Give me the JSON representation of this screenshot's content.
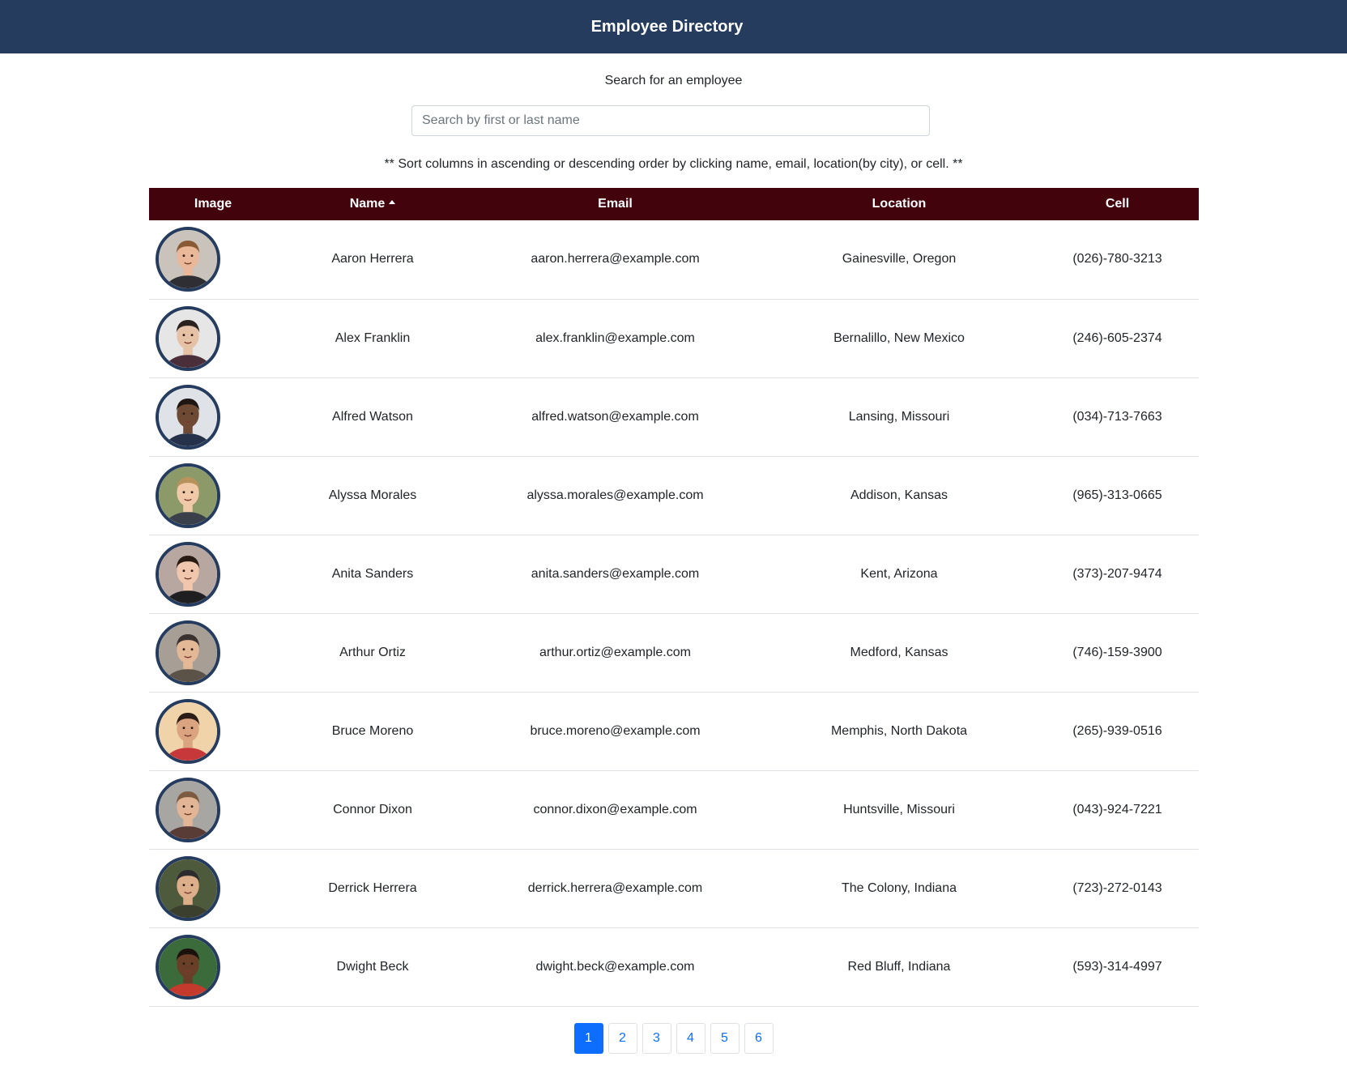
{
  "header": {
    "title": "Employee Directory"
  },
  "search": {
    "label": "Search for an employee",
    "placeholder": "Search by first or last name",
    "value": ""
  },
  "sort_note": "** Sort columns in ascending or descending order by clicking name, email, location(by city), or cell. **",
  "table": {
    "columns": [
      "Image",
      "Name",
      "Email",
      "Location",
      "Cell"
    ],
    "sorted_by": "Name",
    "sort_direction": "ascending",
    "rows": [
      {
        "name": "Aaron Herrera",
        "email": "aaron.herrera@example.com",
        "location": "Gainesville, Oregon",
        "cell": "(026)-780-3213",
        "bg": "#c9c3bb",
        "skin": "#e9b79a",
        "hair": "#8a5a34",
        "shirt": "#2f2f33"
      },
      {
        "name": "Alex Franklin",
        "email": "alex.franklin@example.com",
        "location": "Bernalillo, New Mexico",
        "cell": "(246)-605-2374",
        "bg": "#e6e6e6",
        "skin": "#e5c1a6",
        "hair": "#2b2220",
        "shirt": "#4a2e3a"
      },
      {
        "name": "Alfred Watson",
        "email": "alfred.watson@example.com",
        "location": "Lansing, Missouri",
        "cell": "(034)-713-7663",
        "bg": "#dfe3e8",
        "skin": "#6e4a35",
        "hair": "#1e1612",
        "shirt": "#26324a"
      },
      {
        "name": "Alyssa Morales",
        "email": "alyssa.morales@example.com",
        "location": "Addison, Kansas",
        "cell": "(965)-313-0665",
        "bg": "#8c9a6a",
        "skin": "#f0c9a9",
        "hair": "#b8925c",
        "shirt": "#39404a"
      },
      {
        "name": "Anita Sanders",
        "email": "anita.sanders@example.com",
        "location": "Kent, Arizona",
        "cell": "(373)-207-9474",
        "bg": "#b8a7a0",
        "skin": "#f0c6ad",
        "hair": "#2a1a14",
        "shirt": "#1f1f22"
      },
      {
        "name": "Arthur Ortiz",
        "email": "arthur.ortiz@example.com",
        "location": "Medford, Kansas",
        "cell": "(746)-159-3900",
        "bg": "#a79f95",
        "skin": "#e3b896",
        "hair": "#3a3230",
        "shirt": "#5b5248"
      },
      {
        "name": "Bruce Moreno",
        "email": "bruce.moreno@example.com",
        "location": "Memphis, North Dakota",
        "cell": "(265)-939-0516",
        "bg": "#f0d3a8",
        "skin": "#d9a47f",
        "hair": "#2a1d17",
        "shirt": "#c6383a"
      },
      {
        "name": "Connor Dixon",
        "email": "connor.dixon@example.com",
        "location": "Huntsville, Missouri",
        "cell": "(043)-924-7221",
        "bg": "#a8a6a3",
        "skin": "#e1b596",
        "hair": "#7b5a40",
        "shirt": "#5a3c36"
      },
      {
        "name": "Derrick Herrera",
        "email": "derrick.herrera@example.com",
        "location": "The Colony, Indiana",
        "cell": "(723)-272-0143",
        "bg": "#4e5a3c",
        "skin": "#dcae8a",
        "hair": "#2c2c2e",
        "shirt": "#3a3f2e"
      },
      {
        "name": "Dwight Beck",
        "email": "dwight.beck@example.com",
        "location": "Red Bluff, Indiana",
        "cell": "(593)-314-4997",
        "bg": "#3b6b3a",
        "skin": "#6a3f28",
        "hair": "#1a110d",
        "shirt": "#c43a2c"
      }
    ]
  },
  "pagination": {
    "pages": [
      "1",
      "2",
      "3",
      "4",
      "5",
      "6"
    ],
    "current": "1"
  },
  "colors": {
    "header_bg": "#263c5e",
    "table_header_bg": "#42030d",
    "accent": "#0d6efd",
    "avatar_border": "#263c5e"
  }
}
